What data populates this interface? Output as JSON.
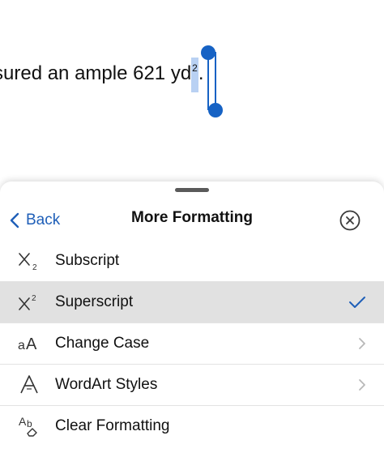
{
  "document": {
    "text_before": "sured an ample 621 yd",
    "selected_superscript": "2",
    "text_after": "."
  },
  "sheet": {
    "back_label": "Back",
    "title": "More Formatting",
    "close_icon": "close-circle-icon"
  },
  "menu": {
    "items": [
      {
        "label": "Subscript",
        "icon": "subscript-icon",
        "selected": false,
        "accessory": "none"
      },
      {
        "label": "Superscript",
        "icon": "superscript-icon",
        "selected": true,
        "accessory": "checkmark"
      },
      {
        "label": "Change Case",
        "icon": "change-case-icon",
        "selected": false,
        "accessory": "chevron"
      },
      {
        "label": "WordArt Styles",
        "icon": "wordart-icon",
        "selected": false,
        "accessory": "chevron"
      },
      {
        "label": "Clear Formatting",
        "icon": "clear-formatting-icon",
        "selected": false,
        "accessory": "none"
      }
    ]
  },
  "colors": {
    "accent": "#1f5fb8",
    "selection_handle": "#1662c4",
    "selection_fill": "#b9d1f3",
    "selected_row": "#e1e1e1"
  }
}
